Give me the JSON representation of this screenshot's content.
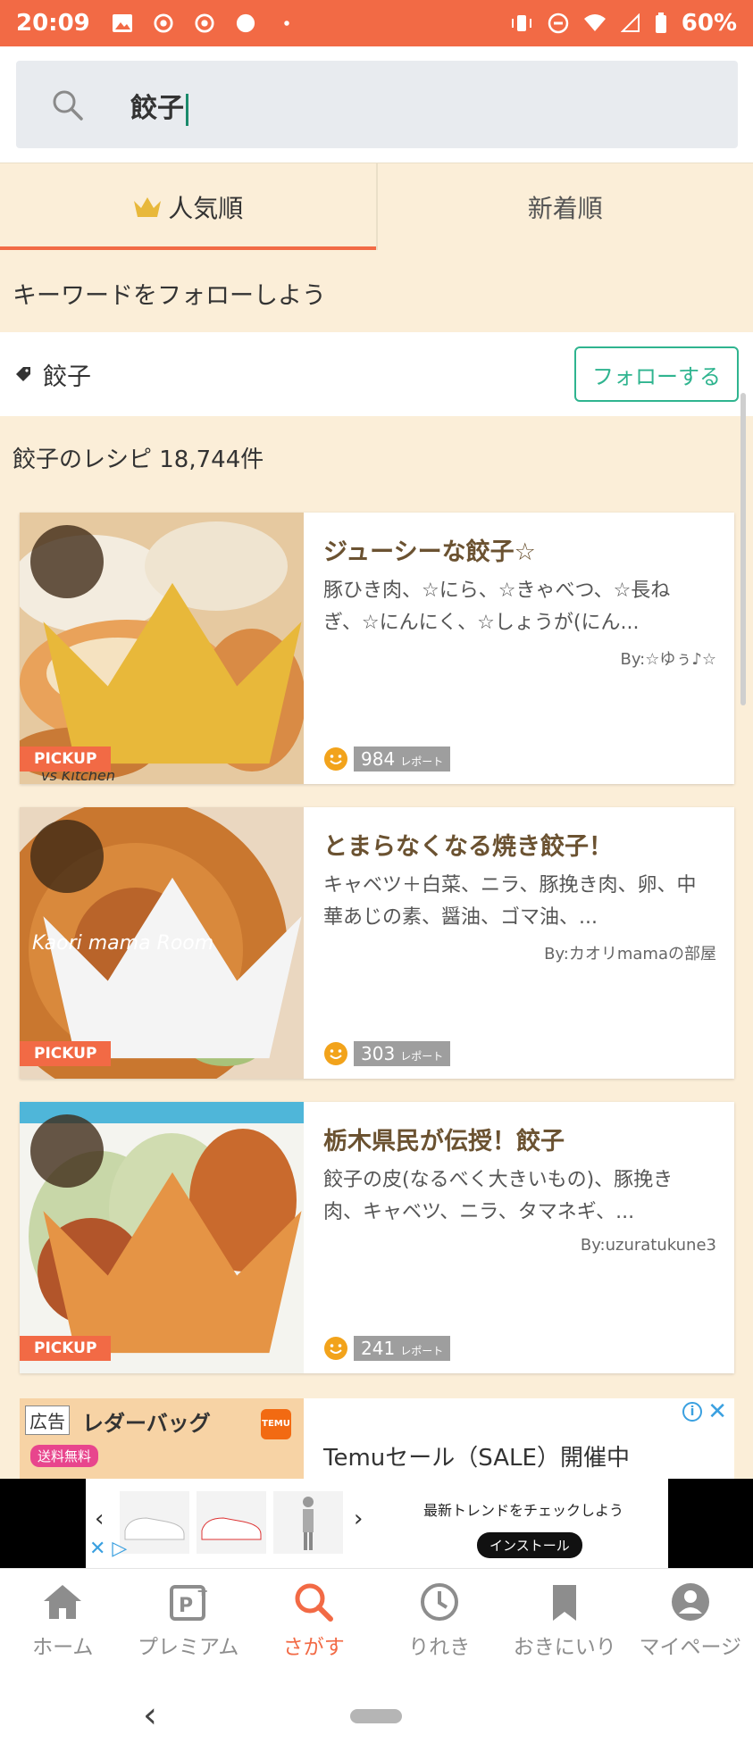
{
  "status_bar": {
    "time": "20:09",
    "battery": "60%"
  },
  "search": {
    "query": "餃子"
  },
  "tabs": [
    {
      "label": "人気順"
    },
    {
      "label": "新着順"
    }
  ],
  "follow": {
    "heading": "キーワードをフォローしよう",
    "keyword": "餃子",
    "button_label": "フォローする"
  },
  "results": {
    "count_text": "餃子のレシピ 18,744件"
  },
  "recipes": [
    {
      "rank": "1位",
      "title": "ジューシーな餃子☆",
      "ingredients": "豚ひき肉、☆にら、☆きゃべつ、☆長ねぎ、☆にんにく、☆しょうが(にん...",
      "author": "By:☆ゆぅ♪☆",
      "reports": "984",
      "report_unit": "レポート",
      "pickup": "PICKUP",
      "photo_caption": "vs Kitchen"
    },
    {
      "rank": "2位",
      "title": "とまらなくなる焼き餃子！",
      "ingredients": "キャベツ＋白菜、ニラ、豚挽き肉、卵、中華あじの素、醤油、ゴマ油、...",
      "author": "By:カオリmamaの部屋",
      "reports": "303",
      "report_unit": "レポート",
      "pickup": "PICKUP",
      "photo_caption": "Kaori mama Room"
    },
    {
      "rank": "3位",
      "title": "栃木県民が伝授！餃子",
      "ingredients": "餃子の皮(なるべく大きいもの)、豚挽き肉、キャベツ、ニラ、タマネギ、...",
      "author": "By:uzuratukune3",
      "reports": "241",
      "report_unit": "レポート",
      "pickup": "PICKUP"
    }
  ],
  "ad": {
    "badge": "広告",
    "product": "レダーバッグ",
    "shipping": "送料無料",
    "text": "Temuセール（SALE）開催中",
    "info": "i",
    "close": "✕"
  },
  "banner_ad": {
    "headline": "最新トレンドをチェックしよう",
    "install": "インストール"
  },
  "bottom_nav": [
    {
      "label": "ホーム",
      "icon": "home-icon"
    },
    {
      "label": "プレミアム",
      "icon": "premium-icon"
    },
    {
      "label": "さがす",
      "icon": "search-icon"
    },
    {
      "label": "りれき",
      "icon": "clock-icon"
    },
    {
      "label": "おきにいり",
      "icon": "bookmark-icon"
    },
    {
      "label": "マイページ",
      "icon": "person-icon"
    }
  ],
  "colors": {
    "accent": "#f26a45",
    "follow_green": "#2fb48f",
    "tab_bg": "#fbeed8",
    "title_brown": "#6b5231"
  }
}
